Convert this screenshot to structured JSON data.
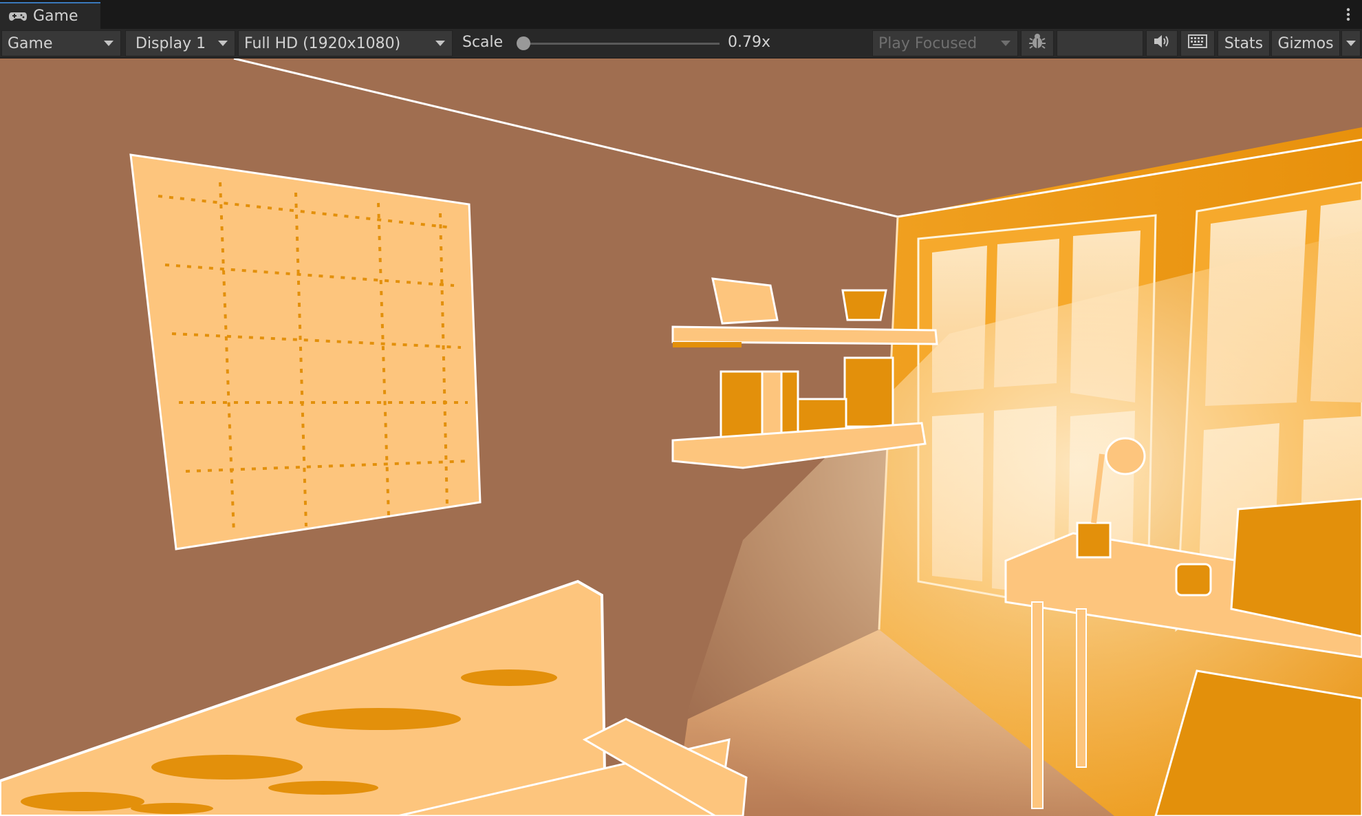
{
  "window": {
    "tab_title": "Game",
    "tab_icon": "gamepad-icon",
    "menu_icon": "kebab-menu-icon"
  },
  "toolbar": {
    "view_mode": "Game",
    "display": "Display 1",
    "resolution": "Full HD (1920x1080)",
    "scale_label": "Scale",
    "scale_value": "0.79x",
    "scale_fraction": 0.0,
    "play_mode": "Play Focused",
    "debug_icon": "bug-icon",
    "mute_icon": "speaker-icon",
    "keyboard_icon": "keyboard-icon",
    "stats_label": "Stats",
    "gizmos_label": "Gizmos"
  },
  "colors": {
    "editor_bg": "#282828",
    "tab_accent": "#3a79bb",
    "wall": "#a06e50",
    "object_light": "#fdc57d",
    "object_dark": "#e3900b",
    "outline": "#ffffff"
  },
  "scene": {
    "description_icon": "game-viewport"
  }
}
